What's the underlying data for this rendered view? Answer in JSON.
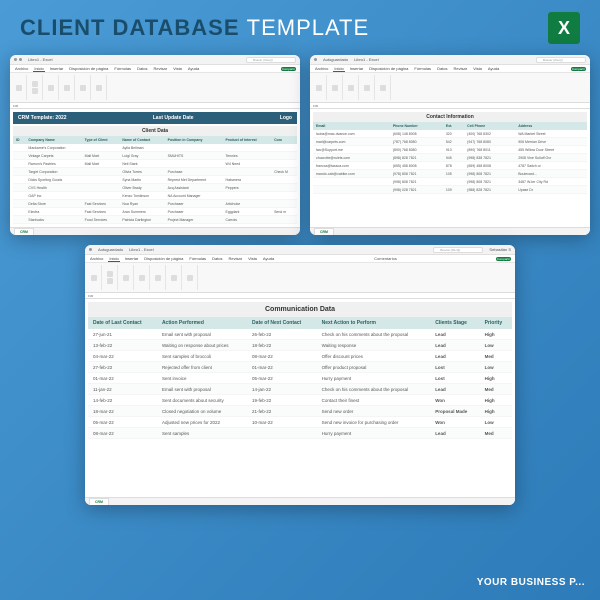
{
  "hero": {
    "title1": "CLIENT DATABASE",
    "title2": "TEMPLATE"
  },
  "excel_logo": "X",
  "footer": "YOUR BUSINESS P...",
  "app": {
    "titlebar": "Libro1 - Excel",
    "autosave": "Autoguardado",
    "search": "Buscar (Alt+Q)",
    "user": "Sebastián S",
    "share": "Compartir",
    "comments": "Comentarios",
    "menus": [
      "Archivo",
      "Inicio",
      "Insertar",
      "Disposición de página",
      "Fórmulas",
      "Datos",
      "Revisar",
      "Vista",
      "Ayuda"
    ],
    "cell_ref": "F30",
    "sheet_tab": "CRM"
  },
  "w1": {
    "crm_title": "CRM Template: 2022",
    "crm_sub1": "Last Update Date",
    "crm_sub2": "Logo",
    "section": "Client Data",
    "headers": [
      "ID",
      "Company Name",
      "Type of Client",
      "Name of Contact",
      "Position in Company",
      "Product of Interest",
      "Com"
    ],
    "rows": [
      [
        "",
        "Mackarne's Corporation",
        "",
        "Aylla Bellman",
        "",
        "",
        ""
      ],
      [
        "",
        "Vintage Carpets",
        "Mall Mart",
        "Luigi Gray",
        "SMUHITS",
        "Tennies",
        ""
      ],
      [
        "",
        "Ramon's Pastries",
        "Mall Mart",
        "Neil Stark",
        "",
        "W4 Need",
        ""
      ],
      [
        "",
        "Target Corporation",
        "",
        "Olivia Torres",
        "Purchase",
        "",
        "Check M"
      ],
      [
        "",
        "Dicks Sporting Goods",
        "",
        "Syna Martin",
        "Represt Met Department",
        "Habanera",
        ""
      ],
      [
        "",
        "CVS Health",
        "",
        "Oliver Brady",
        "Acq Assistant",
        "Peppers",
        ""
      ],
      [
        "",
        "GAP Inc",
        "",
        "Kenzo Tomlinson",
        "NA Account Manager",
        "",
        ""
      ],
      [
        "",
        "Delta Store",
        "Fast Services",
        "Noa Ryan",
        "Purchaser",
        "Artichoke",
        ""
      ],
      [
        "",
        "Electra",
        "Fast Services",
        "Aran Summers",
        "Purchaser",
        "Eggplant",
        "Send m"
      ],
      [
        "",
        "Starbucks",
        "Food Services",
        "Patricia Darlington",
        "Project Manager",
        "Carrots",
        ""
      ]
    ]
  },
  "w2": {
    "section": "Contact Information",
    "headers": [
      "Email",
      "Phone Number",
      "Ext.",
      "Cell Phone",
      "Address"
    ],
    "rows": [
      [
        "lcoba@mac-dvance.com",
        "(608) 148 8008",
        "320",
        "(400) 768 8302",
        "WA Market Street"
      ],
      [
        "mari@carpets.com",
        "(787) 768 8080",
        "542",
        "(947) 768 8080",
        "906 Merrian Drive"
      ],
      [
        "lwu@Support.me",
        "(890) 768 8080",
        "910",
        "(890) 768 8011",
        "455 Willow Door Street"
      ],
      [
        "chucrotte@ruiets.com",
        "(898) 828 7821",
        "945",
        "(998) 838 7821",
        "2908 Vine Sulluff Ovr"
      ],
      [
        "francca@tassca.com",
        "(655) 458 8008",
        "878",
        "(659) 458 8008",
        "4787 Saitch or"
      ],
      [
        "mando-cab@cabike.com",
        "(978) 808 7821",
        "105",
        "(998) 808 7821",
        "Boulevard..."
      ],
      [
        "",
        "(998) 808 7821",
        "",
        "(998) 808 7821",
        "3487 W-ter City Rd"
      ],
      [
        "",
        "(998) 028 7821",
        "109",
        "(988) 828 7821",
        "Upase Dr"
      ]
    ]
  },
  "w3": {
    "section": "Communication Data",
    "headers": [
      "Date of Last Contact",
      "Action Performed",
      "Date of Next Contact",
      "Next Action to Perform",
      "Clients Stage",
      "Priority"
    ],
    "rows": [
      [
        "27-jun-21",
        "Email sent with proposal",
        "26-feb-22",
        "Check on his comments about the proposal",
        "Lead",
        "High"
      ],
      [
        "13-feb-22",
        "Waiting on response about prices",
        "18-feb-22",
        "Waiting response",
        "Lead",
        "Low"
      ],
      [
        "04-mar-22",
        "Sent samples of broccoli",
        "08-mar-22",
        "Offer discount prices",
        "Lead",
        "Med"
      ],
      [
        "27-feb-22",
        "Rejected offer from client",
        "01-mar-22",
        "Offer product proposal",
        "Lost",
        "Low"
      ],
      [
        "01-mar-22",
        "Sent invoice",
        "05-mar-22",
        "Hurry payment",
        "Lost",
        "High"
      ],
      [
        "11-jan-22",
        "Email sent with proposal",
        "14-jan-22",
        "Check on his comments about the proposal",
        "Lead",
        "Med"
      ],
      [
        "14-feb-22",
        "Sent documents about security",
        "19-feb-22",
        "Contact their finest",
        "Won",
        "High"
      ],
      [
        "18-mar-22",
        "Closed negotiation on volume",
        "21-feb-22",
        "Send new order",
        "Proposal Made",
        "High"
      ],
      [
        "05-mar-22",
        "Adjusted new prices for 2022",
        "10-mar-22",
        "Send new invoice for purchasing order",
        "Won",
        "Low"
      ],
      [
        "08-mar-22",
        "Sent samples",
        "",
        "Hurry payment",
        "Lead",
        "Med"
      ]
    ]
  }
}
